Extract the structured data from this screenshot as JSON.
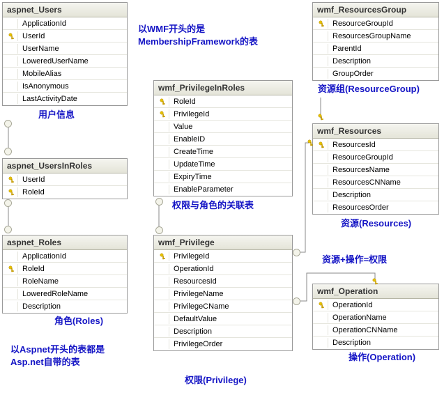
{
  "tables": {
    "aspnet_Users": {
      "title": "aspnet_Users",
      "cols": [
        {
          "name": "ApplicationId",
          "pk": false
        },
        {
          "name": "UserId",
          "pk": true
        },
        {
          "name": "UserName",
          "pk": false
        },
        {
          "name": "LoweredUserName",
          "pk": false
        },
        {
          "name": "MobileAlias",
          "pk": false
        },
        {
          "name": "IsAnonymous",
          "pk": false
        },
        {
          "name": "LastActivityDate",
          "pk": false
        }
      ],
      "cap": "用户信息"
    },
    "aspnet_UsersInRoles": {
      "title": "aspnet_UsersInRoles",
      "cols": [
        {
          "name": "UserId",
          "pk": true
        },
        {
          "name": "RoleId",
          "pk": true
        }
      ]
    },
    "aspnet_Roles": {
      "title": "aspnet_Roles",
      "cols": [
        {
          "name": "ApplicationId",
          "pk": false
        },
        {
          "name": "RoleId",
          "pk": true
        },
        {
          "name": "RoleName",
          "pk": false
        },
        {
          "name": "LoweredRoleName",
          "pk": false
        },
        {
          "name": "Description",
          "pk": false
        }
      ],
      "cap": "角色(Roles)"
    },
    "wmf_PrivilegeInRoles": {
      "title": "wmf_PrivilegeInRoles",
      "cols": [
        {
          "name": "RoleId",
          "pk": true
        },
        {
          "name": "PrivilegeId",
          "pk": true
        },
        {
          "name": "Value",
          "pk": false
        },
        {
          "name": "EnableID",
          "pk": false
        },
        {
          "name": "CreateTime",
          "pk": false
        },
        {
          "name": "UpdateTime",
          "pk": false
        },
        {
          "name": "ExpiryTime",
          "pk": false
        },
        {
          "name": "EnableParameter",
          "pk": false
        }
      ],
      "cap": "权限与角色的关联表"
    },
    "wmf_Privilege": {
      "title": "wmf_Privilege",
      "cols": [
        {
          "name": "PrivilegeId",
          "pk": true
        },
        {
          "name": "OperationId",
          "pk": false
        },
        {
          "name": "ResourcesId",
          "pk": false
        },
        {
          "name": "PrivilegeName",
          "pk": false
        },
        {
          "name": "PrivilegeCName",
          "pk": false
        },
        {
          "name": "DefaultValue",
          "pk": false
        },
        {
          "name": "Description",
          "pk": false
        },
        {
          "name": "PrivilegeOrder",
          "pk": false
        }
      ],
      "cap": "权限(Privilege)"
    },
    "wmf_ResourcesGroup": {
      "title": "wmf_ResourcesGroup",
      "cols": [
        {
          "name": "ResourceGroupId",
          "pk": true
        },
        {
          "name": "ResourcesGroupName",
          "pk": false
        },
        {
          "name": "ParentId",
          "pk": false
        },
        {
          "name": "Description",
          "pk": false
        },
        {
          "name": "GroupOrder",
          "pk": false
        }
      ],
      "cap": "资源组(ResourceGroup)"
    },
    "wmf_Resources": {
      "title": "wmf_Resources",
      "cols": [
        {
          "name": "ResourcesId",
          "pk": true
        },
        {
          "name": "ResourceGroupId",
          "pk": false
        },
        {
          "name": "ResourcesName",
          "pk": false
        },
        {
          "name": "ResourcesCNName",
          "pk": false
        },
        {
          "name": "Description",
          "pk": false
        },
        {
          "name": "ResourcesOrder",
          "pk": false
        }
      ],
      "cap": "资源(Resources)"
    },
    "wmf_Operation": {
      "title": "wmf_Operation",
      "cols": [
        {
          "name": "OperationId",
          "pk": true
        },
        {
          "name": "OperationName",
          "pk": false
        },
        {
          "name": "OperationCNName",
          "pk": false
        },
        {
          "name": "Description",
          "pk": false
        }
      ],
      "cap": "操作(Operation)"
    }
  },
  "notes": {
    "wmf_head": "以WMF开头的是\nMembershipFramework的表",
    "aspnet_head": "以Aspnet开头的表都是\nAsp.net自带的表",
    "resplusop": "资源+操作=权限"
  }
}
